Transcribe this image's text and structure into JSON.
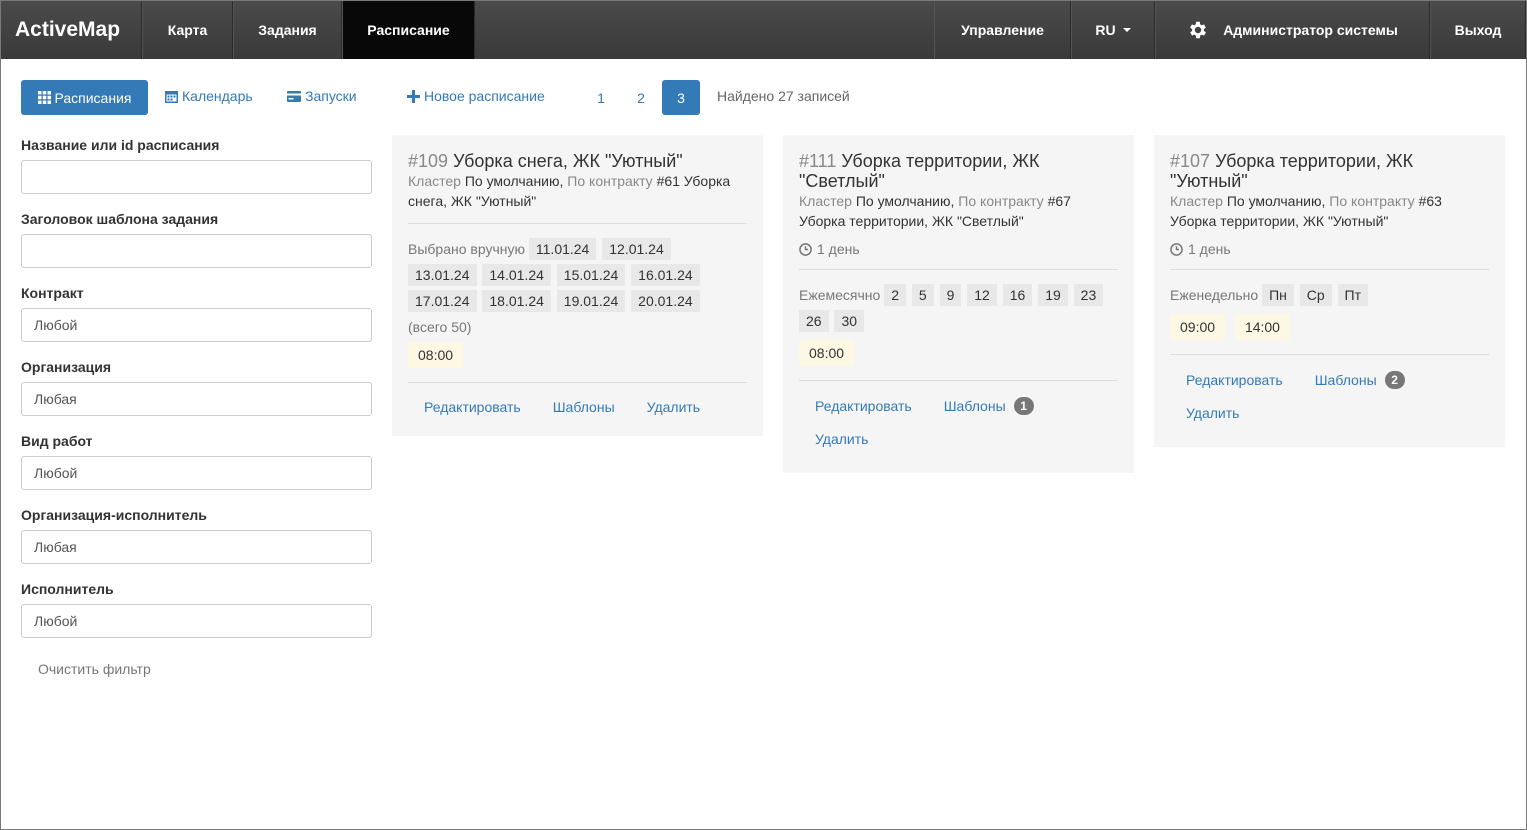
{
  "navbar": {
    "brand": "ActiveMap",
    "left_items": [
      {
        "label": "Карта"
      },
      {
        "label": "Задания"
      },
      {
        "label": "Расписание"
      }
    ],
    "right_items": {
      "manage": "Управление",
      "lang": "RU",
      "user": "Администратор системы",
      "logout": "Выход"
    }
  },
  "toolbar": {
    "schedules": "Расписания",
    "calendar": "Календарь",
    "runs": "Запуски",
    "new_schedule": "Новое расписание",
    "pages": [
      "1",
      "2",
      "3"
    ],
    "current_page": "3",
    "found": "Найдено 27 записей"
  },
  "filter": {
    "fields": [
      {
        "label": "Название или id расписания",
        "value": ""
      },
      {
        "label": "Заголовок шаблона задания",
        "value": ""
      },
      {
        "label": "Контракт",
        "value": "Любой"
      },
      {
        "label": "Организация",
        "value": "Любая"
      },
      {
        "label": "Вид работ",
        "value": "Любой"
      },
      {
        "label": "Организация-исполнитель",
        "value": "Любая"
      },
      {
        "label": "Исполнитель",
        "value": "Любой"
      }
    ],
    "clear": "Очистить фильтр"
  },
  "cards": [
    {
      "id": "#109",
      "title": "Уборка снега, ЖК \"Уютный\"",
      "cluster_label": "Кластер",
      "cluster": "По умолчанию,",
      "contract_label": "По контракту",
      "contract": "#61 Уборка снега, ЖК \"Уютный\"",
      "schedule_label": "Выбрано вручную",
      "dates": [
        "11.01.24",
        "12.01.24",
        "13.01.24",
        "14.01.24",
        "15.01.24",
        "16.01.24",
        "17.01.24",
        "18.01.24",
        "19.01.24",
        "20.01.24"
      ],
      "total": "(всего 50)",
      "times": [
        "08:00"
      ],
      "edit": "Редактировать",
      "templates": "Шаблоны",
      "templates_count": "",
      "delete": "Удалить"
    },
    {
      "id": "#111",
      "title": "Уборка территории, ЖК \"Светлый\"",
      "cluster_label": "Кластер",
      "cluster": "По умолчанию,",
      "contract_label": "По контракту",
      "contract": "#67 Уборка территории, ЖК \"Светлый\"",
      "duration": "1 день",
      "schedule_label": "Ежемесячно",
      "days": [
        "2",
        "5",
        "9",
        "12",
        "16",
        "19",
        "23",
        "26",
        "30"
      ],
      "times": [
        "08:00"
      ],
      "edit": "Редактировать",
      "templates": "Шаблоны",
      "templates_count": "1",
      "delete": "Удалить"
    },
    {
      "id": "#107",
      "title": "Уборка территории, ЖК \"Уютный\"",
      "cluster_label": "Кластер",
      "cluster": "По умолчанию,",
      "contract_label": "По контракту",
      "contract": "#63 Уборка территории, ЖК \"Уютный\"",
      "duration": "1 день",
      "schedule_label": "Еженедельно",
      "days": [
        "Пн",
        "Ср",
        "Пт"
      ],
      "times": [
        "09:00",
        "14:00"
      ],
      "edit": "Редактировать",
      "templates": "Шаблоны",
      "templates_count": "2",
      "delete": "Удалить"
    }
  ],
  "colors": {
    "navbar": "#3f3f3f",
    "nav_active": "#080808",
    "accent": "#337ab7",
    "card_bg": "#f5f5f5",
    "time_chip": "#fcf8e3"
  }
}
